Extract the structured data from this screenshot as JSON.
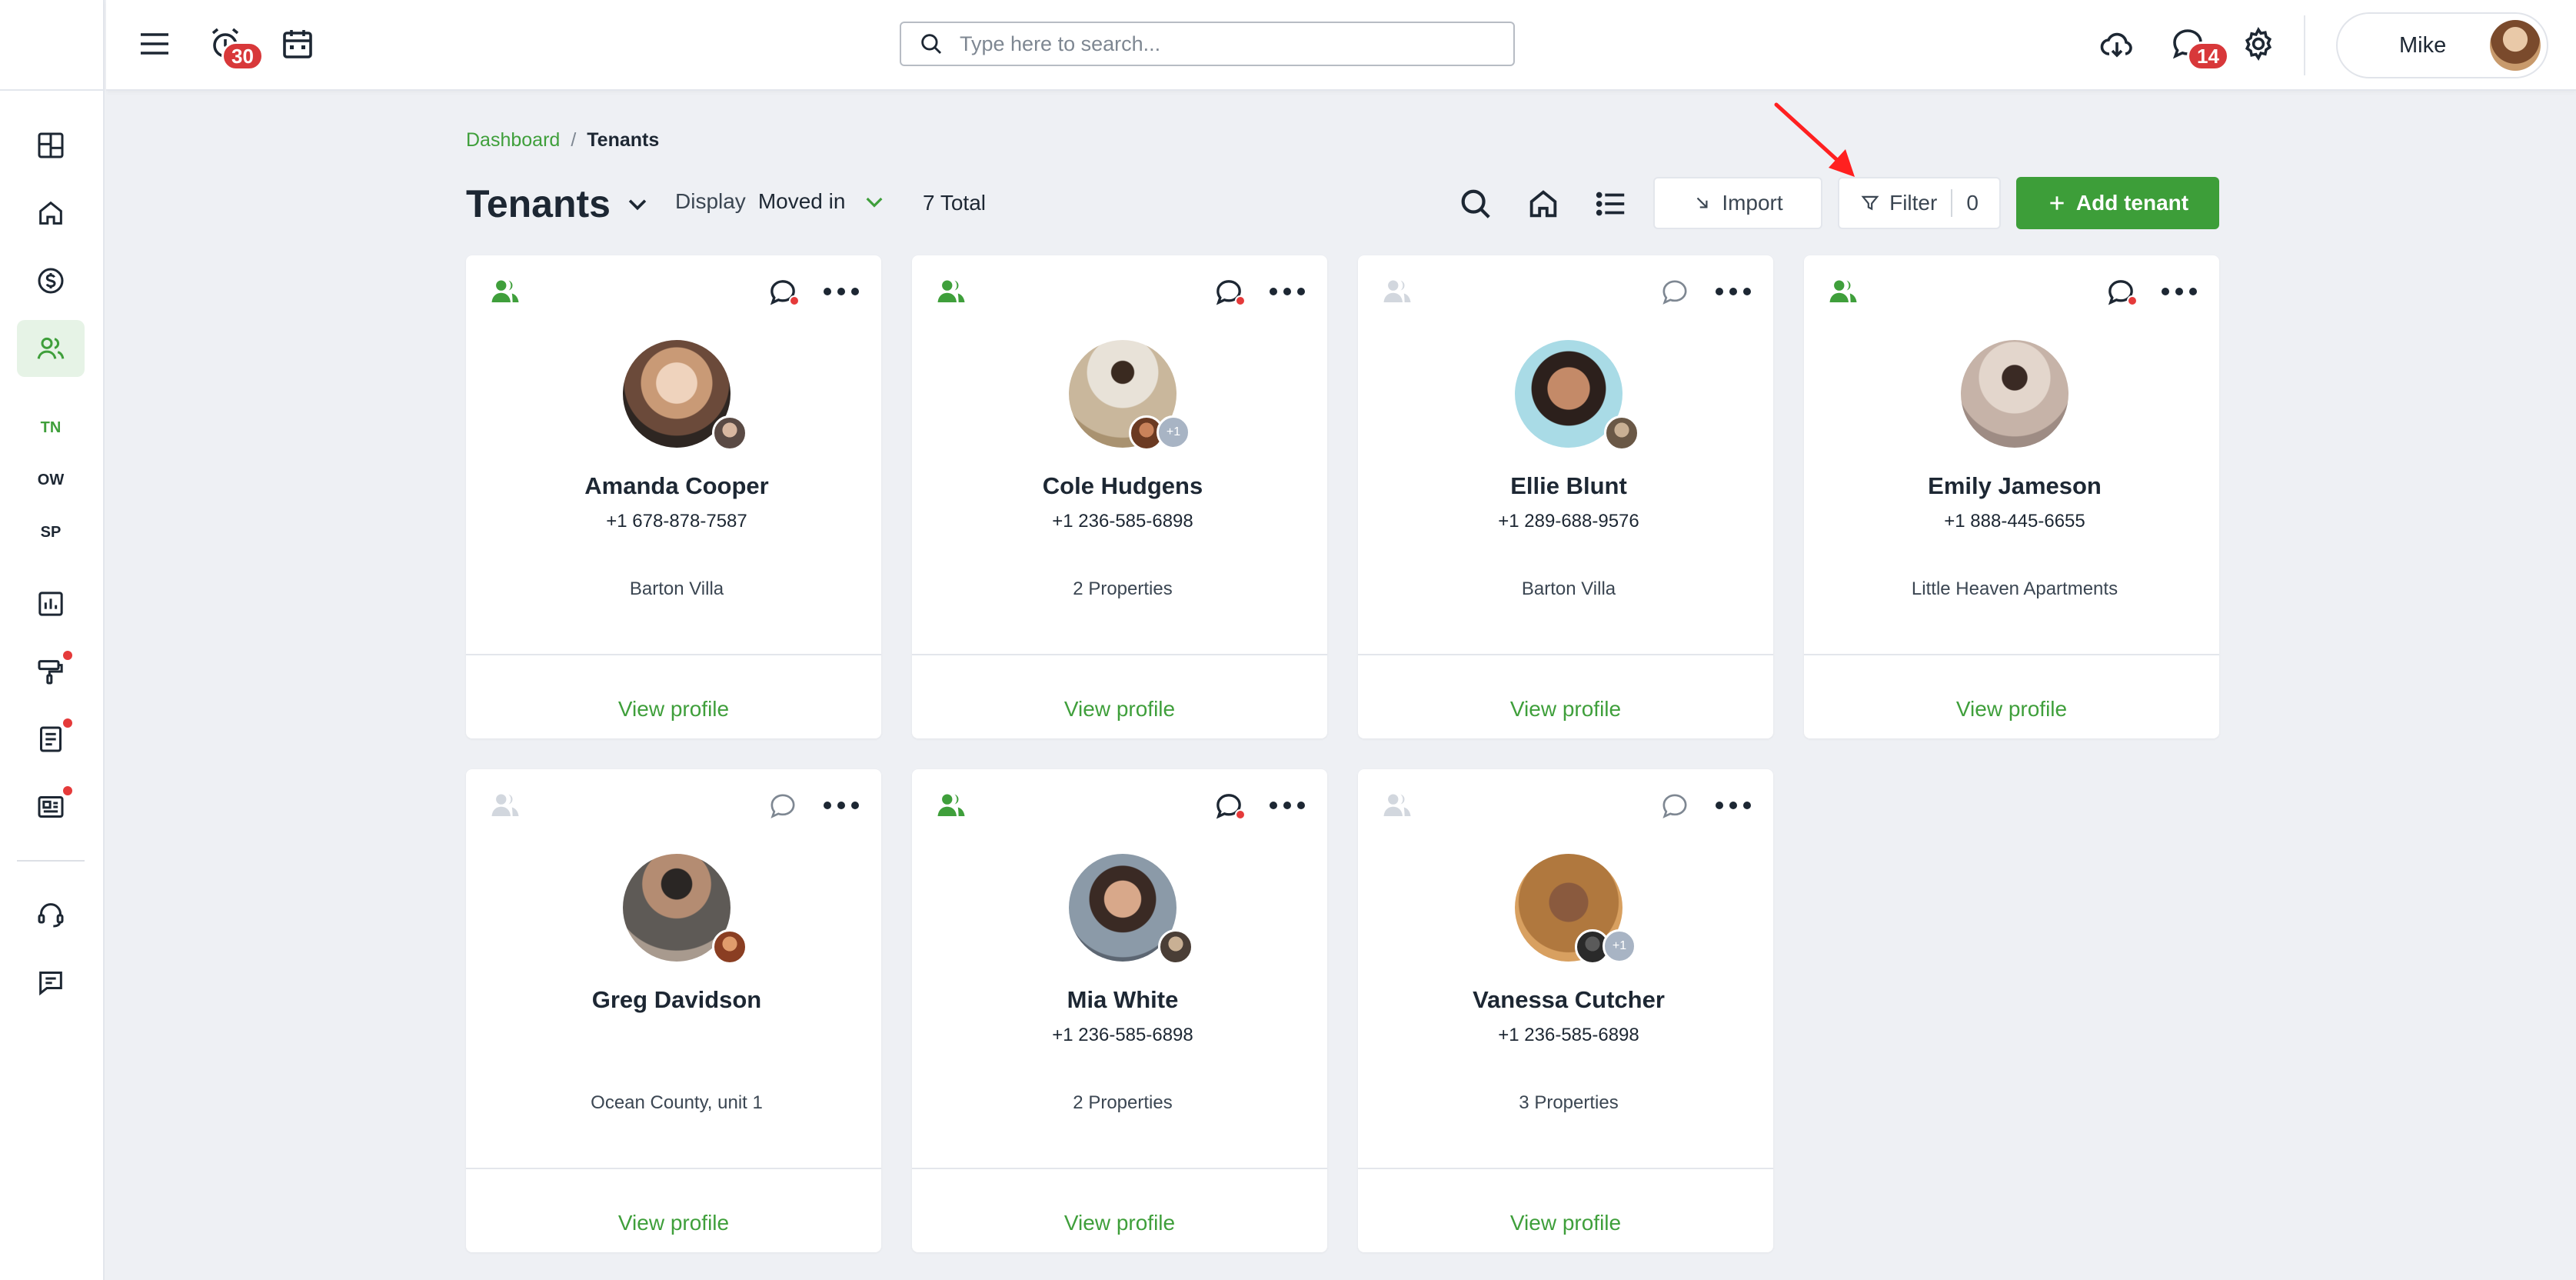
{
  "topbar": {
    "alarm_badge": "30",
    "messages_badge": "14",
    "search_placeholder": "Type here to search...",
    "user_name": "Mike"
  },
  "sidebar": {
    "items": [
      {
        "icon": "dashboard-icon"
      },
      {
        "icon": "home-icon"
      },
      {
        "icon": "dollar-icon"
      },
      {
        "icon": "users-icon",
        "active": true
      },
      {
        "label": "TN"
      },
      {
        "label": "OW"
      },
      {
        "label": "SP"
      },
      {
        "icon": "report-icon"
      },
      {
        "icon": "maintenance-icon"
      },
      {
        "icon": "document-icon"
      },
      {
        "icon": "news-icon"
      },
      {
        "icon": "support-icon"
      },
      {
        "icon": "feedback-icon"
      }
    ]
  },
  "breadcrumb": {
    "parent": "Dashboard",
    "separator": "/",
    "current": "Tenants"
  },
  "header": {
    "title": "Tenants",
    "display_label": "Display",
    "display_value": "Moved in",
    "total": "7 Total",
    "import_label": "Import",
    "filter_label": "Filter",
    "filter_count": "0",
    "add_label": "Add tenant"
  },
  "colors": {
    "accent": "#3d9e39",
    "badge": "#d8383a",
    "annotation_arrow": "#ff2020"
  },
  "tenants": [
    {
      "name": "Amanda Cooper",
      "phone": "+1 678-878-7587",
      "property": "Barton Villa",
      "link": "View profile"
    },
    {
      "name": "Cole Hudgens",
      "phone": "+1 236-585-6898",
      "property": "2 Properties",
      "link": "View profile",
      "extra": "+1"
    },
    {
      "name": "Ellie Blunt",
      "phone": "+1 289-688-9576",
      "property": "Barton Villa",
      "link": "View profile"
    },
    {
      "name": "Emily Jameson",
      "phone": "+1 888-445-6655",
      "property": "Little Heaven Apartments",
      "link": "View profile"
    },
    {
      "name": "Greg Davidson",
      "phone": "",
      "property": "Ocean County, unit 1",
      "link": "View profile"
    },
    {
      "name": "Mia White",
      "phone": "+1 236-585-6898",
      "property": "2 Properties",
      "link": "View profile"
    },
    {
      "name": "Vanessa Cutcher",
      "phone": "+1 236-585-6898",
      "property": "3 Properties",
      "link": "View profile",
      "extra": "+1"
    }
  ]
}
